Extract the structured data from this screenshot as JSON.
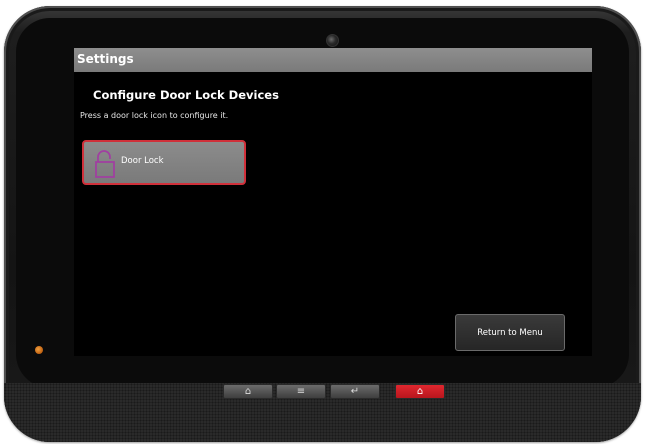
{
  "device": {
    "colors": {
      "frame": "#1a1a1a",
      "accent_led": "#e08a2a",
      "emergency_button": "#d7212a"
    },
    "hardware_buttons": [
      {
        "name": "home",
        "icon": "home-icon",
        "glyph": "⌂"
      },
      {
        "name": "menu",
        "icon": "menu-icon",
        "glyph": "≡"
      },
      {
        "name": "back",
        "icon": "back-icon",
        "glyph": "↵"
      },
      {
        "name": "emergency",
        "icon": "emergency-icon",
        "glyph": "⌂"
      }
    ]
  },
  "screen": {
    "title": "Settings",
    "heading": "Configure Door Lock Devices",
    "instruction": "Press a door lock icon to configure it.",
    "devices": [
      {
        "label": "Door Lock",
        "icon": "unlocked-padlock-icon",
        "selected": true
      }
    ],
    "return_button": "Return to Menu",
    "colors": {
      "titlebar": "#808080",
      "selected_border": "#d0303a",
      "lock_icon": "#a040a0"
    }
  }
}
